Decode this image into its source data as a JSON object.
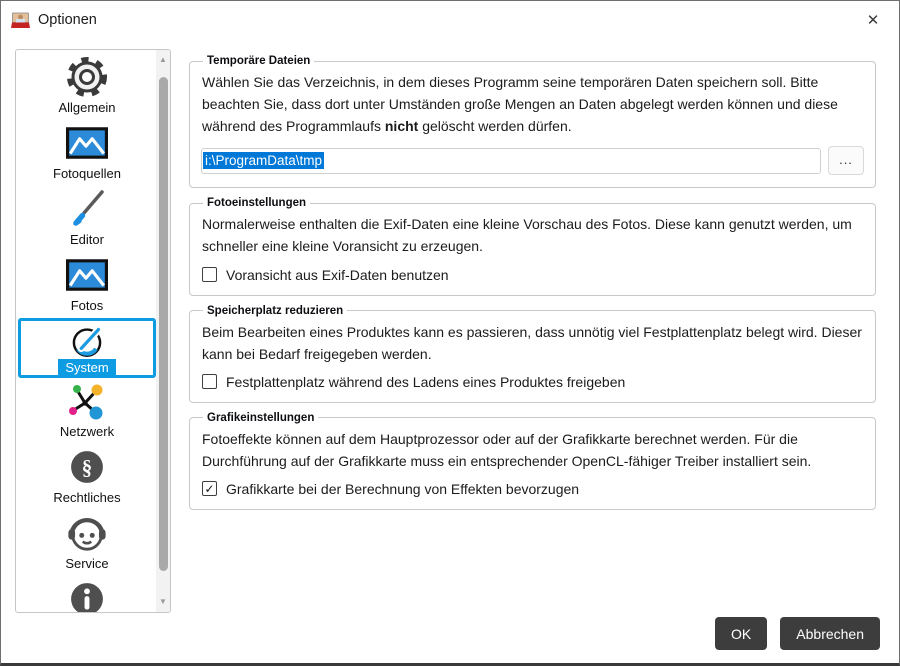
{
  "window": {
    "title": "Optionen"
  },
  "glyphs": {
    "close": "✕",
    "checkmark": "✓",
    "scroll_up": "▲",
    "scroll_down": "▼"
  },
  "colors": {
    "accent_blue": "#0d9ce2",
    "selection_blue": "#0078d7",
    "button_dark_gray": "#3d3d3d"
  },
  "sidebar": {
    "items": [
      {
        "icon": "gear-icon",
        "label": "Allgemein",
        "selected": false
      },
      {
        "icon": "photo-icon",
        "label": "Fotoquellen",
        "selected": false
      },
      {
        "icon": "paintbrush-icon",
        "label": "Editor",
        "selected": false
      },
      {
        "icon": "photo-icon",
        "label": "Fotos",
        "selected": false
      },
      {
        "icon": "gauge-icon",
        "label": "System",
        "selected": true
      },
      {
        "icon": "network-icon",
        "label": "Netzwerk",
        "selected": false
      },
      {
        "icon": "section-sign-icon",
        "label": "Rechtliches",
        "selected": false
      },
      {
        "icon": "headset-icon",
        "label": "Service",
        "selected": false
      },
      {
        "icon": "info-icon",
        "label": "",
        "selected": false
      }
    ]
  },
  "sections": [
    {
      "title": "Temporäre Dateien",
      "description_part1": "Wählen Sie das Verzeichnis, in dem dieses Programm seine temporären Daten speichern soll. Bitte beachten Sie, dass dort unter Umständen große Mengen an Daten abgelegt werden können und diese während des Programmlaufs ",
      "description_bold": "nicht",
      "description_part2": " gelöscht werden dürfen.",
      "path_value": "i:\\ProgramData\\tmp",
      "browse_label": "..."
    },
    {
      "title": "Fotoeinstellungen",
      "description": "Normalerweise enthalten die Exif-Daten eine kleine Vorschau des Fotos. Diese kann genutzt werden, um schneller eine kleine Voransicht zu erzeugen.",
      "checkbox": {
        "label": "Voransicht aus Exif-Daten benutzen",
        "checked": false
      }
    },
    {
      "title": "Speicherplatz reduzieren",
      "description": "Beim Bearbeiten eines Produktes kann es passieren, dass unnötig viel Festplattenplatz belegt wird. Dieser kann bei Bedarf freigegeben werden.",
      "checkbox": {
        "label": "Festplattenplatz während des Ladens eines Produktes freigeben",
        "checked": false
      }
    },
    {
      "title": "Grafikeinstellungen",
      "description": "Fotoeffekte können auf dem Hauptprozessor oder auf der Grafikkarte berechnet werden. Für die Durchführung auf der Grafikkarte muss ein entsprechender OpenCL-fähiger Treiber installiert sein.",
      "checkbox": {
        "label": "Grafikkarte bei der Berechnung von Effekten bevorzugen",
        "checked": true
      }
    }
  ],
  "footer": {
    "ok_label": "OK",
    "cancel_label": "Abbrechen"
  }
}
